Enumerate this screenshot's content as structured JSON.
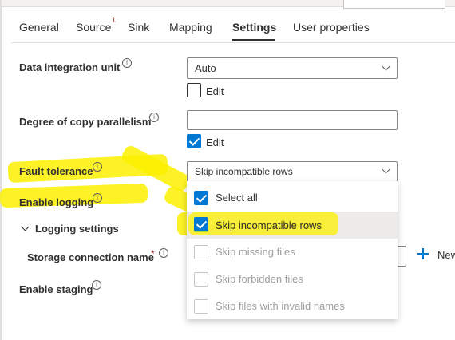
{
  "tabs": [
    {
      "label": "General",
      "active": false
    },
    {
      "label": "Source",
      "active": false,
      "badge": "1"
    },
    {
      "label": "Sink",
      "active": false
    },
    {
      "label": "Mapping",
      "active": false
    },
    {
      "label": "Settings",
      "active": true
    },
    {
      "label": "User properties",
      "active": false
    }
  ],
  "fields": {
    "data_integration_unit": {
      "label": "Data integration unit",
      "value": "Auto",
      "edit_label": "Edit",
      "edit_checked": false
    },
    "degree_of_parallelism": {
      "label": "Degree of copy parallelism",
      "value": "",
      "edit_label": "Edit",
      "edit_checked": true
    },
    "fault_tolerance": {
      "label": "Fault tolerance",
      "value": "Skip incompatible rows"
    },
    "enable_logging": {
      "label": "Enable logging"
    },
    "logging_settings": {
      "label": "Logging settings"
    },
    "storage_connection": {
      "label": "Storage connection name",
      "required_marker": "*",
      "new_label": "New"
    },
    "enable_staging": {
      "label": "Enable staging"
    }
  },
  "fault_tolerance_options": [
    {
      "label": "Select all",
      "checked": true,
      "disabled": false
    },
    {
      "label": "Skip incompatible rows",
      "checked": true,
      "disabled": false
    },
    {
      "label": "Skip missing files",
      "checked": false,
      "disabled": true
    },
    {
      "label": "Skip forbidden files",
      "checked": false,
      "disabled": true
    },
    {
      "label": "Skip files with invalid names",
      "checked": false,
      "disabled": true
    }
  ],
  "info_icon_glyph": "i",
  "colors": {
    "accent": "#0078d4",
    "highlight": "#fbf000",
    "required": "#a4262c"
  }
}
